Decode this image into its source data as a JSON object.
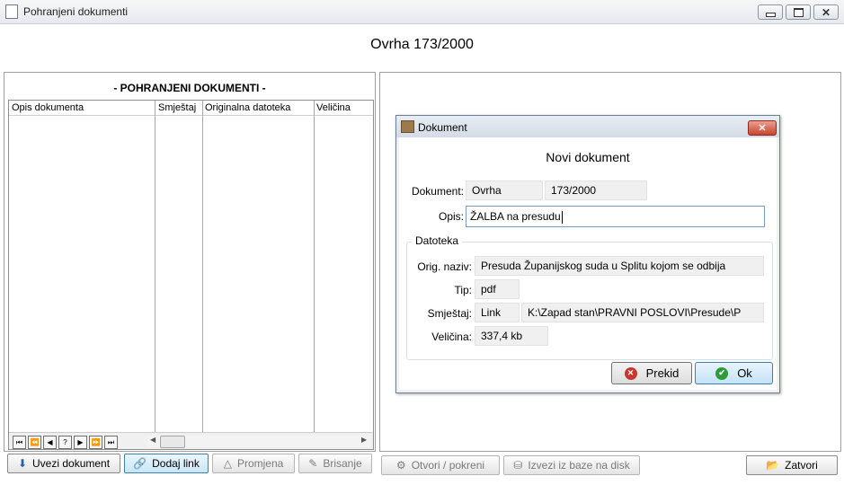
{
  "window": {
    "title": "Pohranjeni dokumenti",
    "controls": {
      "minimize": "",
      "maximize": "",
      "close": "✕"
    }
  },
  "case_title": "Ovrha 173/2000",
  "left_panel": {
    "heading": "- POHRANJENI DOKUMENTI -",
    "columns": [
      "Opis dokumenta",
      "Smještaj",
      "Originalna datoteka",
      "Veličina"
    ],
    "nav_buttons": [
      "⏮",
      "⏪",
      "◀",
      "?",
      "▶",
      "⏩",
      "⏭"
    ],
    "scroll_left": "◀",
    "scroll_right": "▶"
  },
  "bottom_buttons": {
    "import": "Uvezi dokument",
    "add_link": "Dodaj link",
    "edit": "Promjena",
    "delete": "Brisanje",
    "open": "Otvori / pokreni",
    "export": "Izvezi iz baze na disk",
    "close": "Zatvori"
  },
  "dialog": {
    "title": "Dokument",
    "close": "✕",
    "heading": "Novi dokument",
    "labels": {
      "document": "Dokument:",
      "description": "Opis:",
      "file_group": "Datoteka",
      "orig_name": "Orig. naziv:",
      "type": "Tip:",
      "location": "Smještaj:",
      "size": "Veličina:"
    },
    "values": {
      "doc_type": "Ovrha",
      "doc_number": "173/2000",
      "description": "ŽALBA na presudu",
      "orig_name": "Presuda Županijskog suda u Splitu kojom se odbija",
      "type": "pdf",
      "location_type": "Link",
      "location_path": "K:\\Zapad stan\\PRAVNI POSLOVI\\Presude\\P",
      "size": "337,4 kb"
    },
    "buttons": {
      "cancel": "Prekid",
      "ok": "Ok"
    }
  },
  "colors": {
    "accent": "#3c7fb1",
    "cancel": "#c8372d",
    "ok": "#2e9a3a"
  }
}
